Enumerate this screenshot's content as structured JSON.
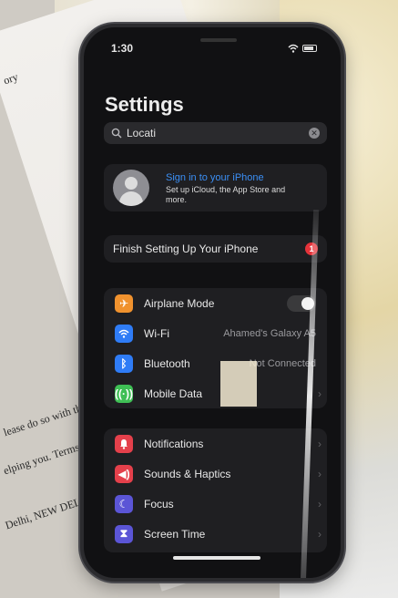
{
  "background": {
    "paper_lines": [
      "ory",
      "lease do so with the Or",
      "elping you. Terms and",
      "Delhi, NEW DELHI, D"
    ]
  },
  "status_bar": {
    "time": "1:30"
  },
  "settings": {
    "title": "Settings",
    "search": {
      "value": "Locati",
      "icon": "search-icon"
    },
    "account": {
      "sign_in": "Sign in to your iPhone",
      "subtitle": "Set up iCloud, the App Store and more."
    },
    "finish_setup": {
      "label": "Finish Setting Up Your iPhone",
      "badge": "1"
    },
    "group_1": [
      {
        "label": "Airplane Mode",
        "icon": "airplane-icon",
        "color": "#f0922e",
        "value": ""
      },
      {
        "label": "Wi-Fi",
        "icon": "wifi-icon",
        "color": "#2f7cf6",
        "value": "Ahamed's Galaxy A5"
      },
      {
        "label": "Bluetooth",
        "icon": "bluetooth-icon",
        "color": "#2f7cf6",
        "value": "Not Connected"
      },
      {
        "label": "Mobile Data",
        "icon": "antenna-icon",
        "color": "#3fbf55",
        "value": ""
      }
    ],
    "group_2": [
      {
        "label": "Notifications",
        "icon": "bell-icon",
        "color": "#e4404b"
      },
      {
        "label": "Sounds & Haptics",
        "icon": "speaker-icon",
        "color": "#e4404b"
      },
      {
        "label": "Focus",
        "icon": "moon-icon",
        "color": "#5b55d6"
      },
      {
        "label": "Screen Time",
        "icon": "hourglass-icon",
        "color": "#5b55d6"
      }
    ]
  }
}
